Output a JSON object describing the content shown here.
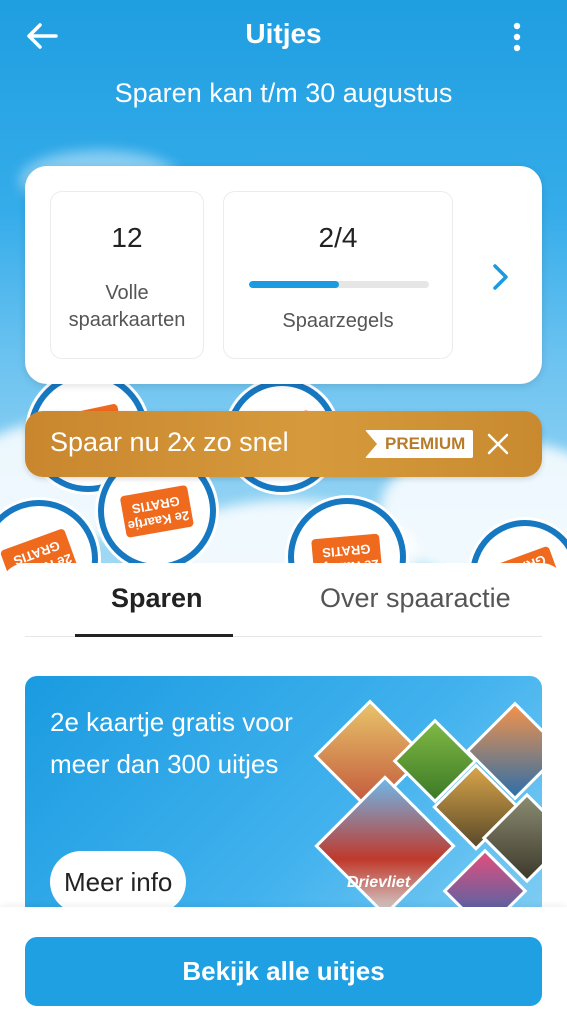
{
  "header": {
    "title": "Uitjes",
    "subtitle": "Sparen kan t/m 30 augustus"
  },
  "stats": {
    "cards_value": "12",
    "cards_label": "Volle spaarkaarten",
    "stamps_value": "2/4",
    "stamps_label": "Spaarzegels",
    "stamps_progress": 0.5
  },
  "promo": {
    "text": "Spaar nu 2x zo snel",
    "badge": "PREMIUM"
  },
  "tabs": [
    {
      "label": "Sparen",
      "active": true
    },
    {
      "label": "Over spaaractie",
      "active": false
    }
  ],
  "banner": {
    "text": "2e kaartje gratis voor meer dan 300 uitjes",
    "button": "Meer info",
    "brand": "Drievliet"
  },
  "cta": {
    "label": "Bekijk alle uitjes"
  },
  "stamp_text": "2e Kaartje GRATIS",
  "colors": {
    "primary": "#1ea0e3",
    "promo": "#c9862e",
    "stamp_orange": "#f06a1e"
  }
}
